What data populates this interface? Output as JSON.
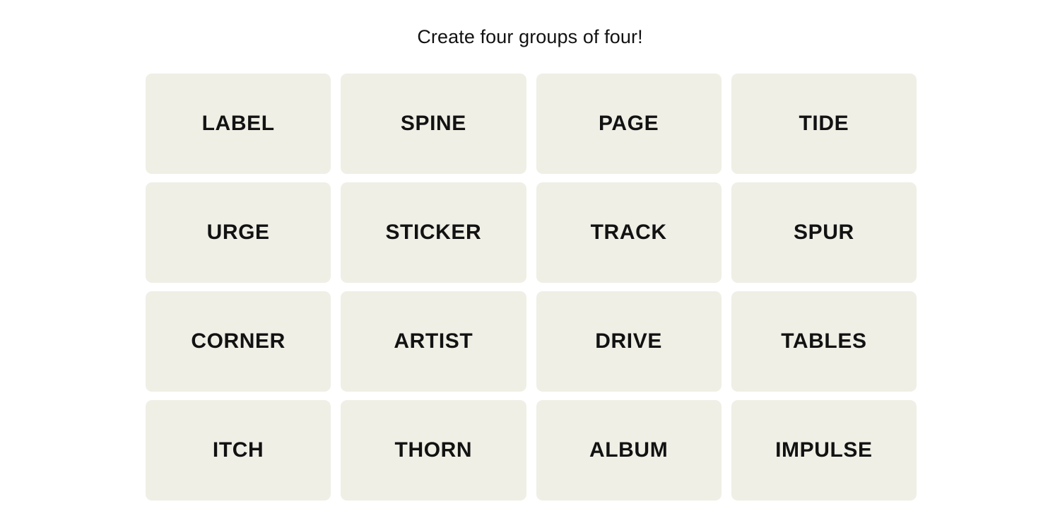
{
  "header": {
    "instruction": "Create four groups of four!"
  },
  "colors": {
    "page_background": "#ffffff",
    "tile_background": "#EFEFE6",
    "text": "#121212"
  },
  "board": {
    "rows": 4,
    "columns": 4,
    "tiles": [
      {
        "label": "LABEL"
      },
      {
        "label": "SPINE"
      },
      {
        "label": "PAGE"
      },
      {
        "label": "TIDE"
      },
      {
        "label": "URGE"
      },
      {
        "label": "STICKER"
      },
      {
        "label": "TRACK"
      },
      {
        "label": "SPUR"
      },
      {
        "label": "CORNER"
      },
      {
        "label": "ARTIST"
      },
      {
        "label": "DRIVE"
      },
      {
        "label": "TABLES"
      },
      {
        "label": "ITCH"
      },
      {
        "label": "THORN"
      },
      {
        "label": "ALBUM"
      },
      {
        "label": "IMPULSE"
      }
    ]
  }
}
